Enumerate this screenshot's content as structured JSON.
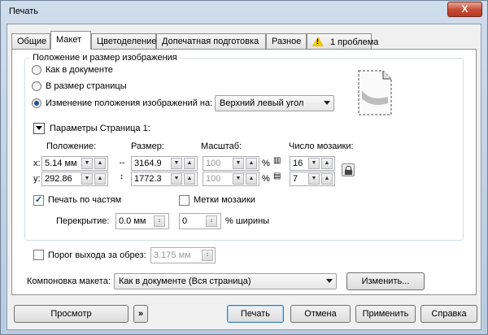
{
  "window": {
    "title": "Печать",
    "close_label": "X"
  },
  "tabs": [
    "Общие",
    "Макет",
    "Цветоделение",
    "Допечатная подготовка",
    "Разное",
    "1 проблема"
  ],
  "image_group": {
    "title": "Положение и размер изображения",
    "radio_as_doc": "Как в документе",
    "radio_fit_page": "В размер страницы",
    "radio_reposition": "Изменение положения изображений на:",
    "position_select": "Верхний левый угол"
  },
  "params": {
    "title": "Параметры Страница 1:",
    "position_label": "Положение:",
    "size_label": "Размер:",
    "scale_label": "Масштаб:",
    "tiles_label": "Число мозаики:",
    "x_label": "x:",
    "y_label": "y:",
    "x_value": "5.14 мм",
    "y_value": "292.86",
    "width_value": "3164.9",
    "height_value": "1772.3",
    "scale_x": "100",
    "scale_y": "100",
    "percent": "%",
    "tiles_x": "16",
    "tiles_y": "7"
  },
  "tiling": {
    "print_tiles_label": "Печать по частям",
    "tile_marks_label": "Метки мозаики",
    "overlap_label": "Перекрытие:",
    "overlap_value": "0.0 мм",
    "width_value": "0",
    "width_unit": "% ширины"
  },
  "bleed": {
    "label": "Порог выхода за обрез:",
    "value": "3.175 мм"
  },
  "imposition": {
    "label": "Компоновка макета:",
    "value": "Как в документе (Вся страница)",
    "edit_label": "Изменить..."
  },
  "footer": {
    "preview": "Просмотр",
    "expand": "»",
    "print": "Печать",
    "cancel": "Отмена",
    "apply": "Применить",
    "help": "Справка"
  }
}
